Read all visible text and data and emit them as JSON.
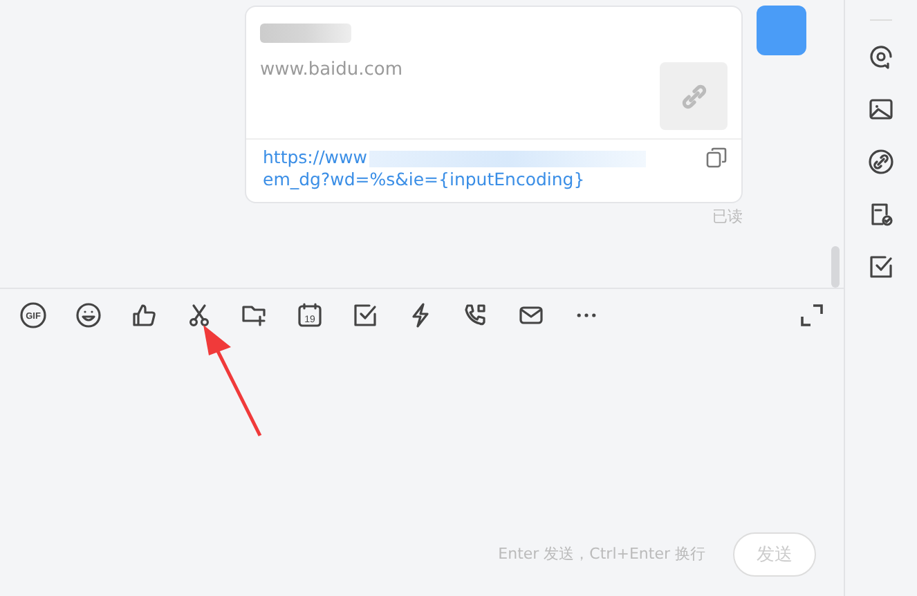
{
  "message": {
    "site": "www.baidu.com",
    "link_start": "https://www",
    "link_end": "em_dg?wd=%s&ie={inputEncoding}",
    "status": "已读"
  },
  "toolbar": [
    {
      "kind": "gif",
      "label": "GIF"
    },
    {
      "kind": "emoji"
    },
    {
      "kind": "like"
    },
    {
      "kind": "scissors"
    },
    {
      "kind": "folder"
    },
    {
      "kind": "calendar",
      "label": "19"
    },
    {
      "kind": "check"
    },
    {
      "kind": "bolt"
    },
    {
      "kind": "call"
    },
    {
      "kind": "mail"
    },
    {
      "kind": "more"
    }
  ],
  "input": {
    "hint": "Enter 发送，Ctrl+Enter 换行",
    "send": "发送",
    "disabled": true
  },
  "sidebar": [
    {
      "kind": "mention"
    },
    {
      "kind": "image"
    },
    {
      "kind": "link"
    },
    {
      "kind": "file-check"
    },
    {
      "kind": "check"
    }
  ]
}
